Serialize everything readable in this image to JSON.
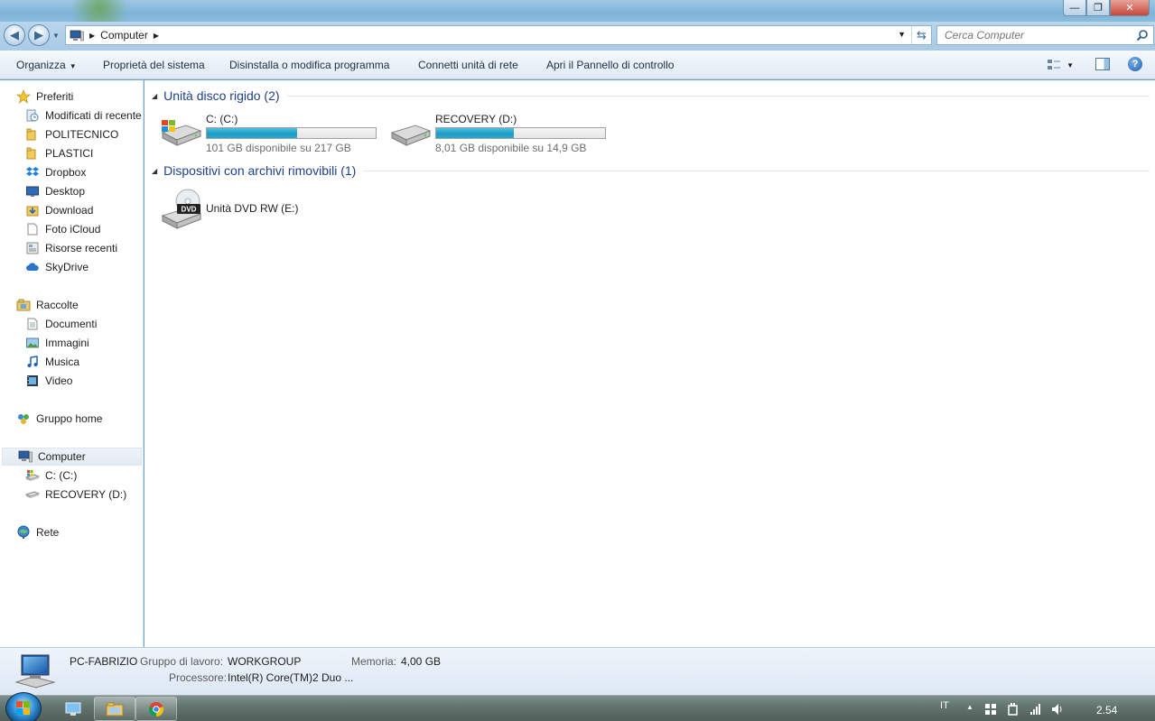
{
  "window": {
    "minimize_label": "—",
    "maximize_label": "❐",
    "close_label": "✕"
  },
  "address": {
    "path": "Computer",
    "search_placeholder": "Cerca Computer"
  },
  "toolbar": {
    "organize": "Organizza",
    "system_properties": "Proprietà del sistema",
    "uninstall": "Disinstalla o modifica programma",
    "map_drive": "Connetti unità di rete",
    "control_panel": "Apri il Pannello di controllo"
  },
  "sidebar": {
    "favorites": "Preferiti",
    "favorites_items": [
      {
        "label": "Modificati di recente",
        "icon": "recent-icon"
      },
      {
        "label": "POLITECNICO",
        "icon": "folder-icon"
      },
      {
        "label": "PLASTICI",
        "icon": "folder-icon"
      },
      {
        "label": "Dropbox",
        "icon": "dropbox-icon"
      },
      {
        "label": "Desktop",
        "icon": "desktop-icon"
      },
      {
        "label": "Download",
        "icon": "download-icon"
      },
      {
        "label": "Foto iCloud",
        "icon": "document-icon"
      },
      {
        "label": "Risorse recenti",
        "icon": "recent-places-icon"
      },
      {
        "label": "SkyDrive",
        "icon": "cloud-icon"
      }
    ],
    "libraries": "Raccolte",
    "libraries_items": [
      {
        "label": "Documenti",
        "icon": "documents-icon"
      },
      {
        "label": "Immagini",
        "icon": "pictures-icon"
      },
      {
        "label": "Musica",
        "icon": "music-icon"
      },
      {
        "label": "Video",
        "icon": "video-icon"
      }
    ],
    "homegroup": "Gruppo home",
    "computer": "Computer",
    "computer_items": [
      {
        "label": "C: (C:)",
        "icon": "windows-drive-icon"
      },
      {
        "label": "RECOVERY (D:)",
        "icon": "drive-icon"
      }
    ],
    "network": "Rete"
  },
  "content": {
    "hdd_group": "Unità disco rigido (2)",
    "removable_group": "Dispositivi con archivi rimovibili (1)",
    "drives": [
      {
        "name": "C: (C:)",
        "free_text": "101 GB disponibile su 217 GB",
        "used_fraction": 0.535
      },
      {
        "name": "RECOVERY (D:)",
        "free_text": "8,01 GB disponibile su 14,9 GB",
        "used_fraction": 0.462
      }
    ],
    "dvd": {
      "name": "Unità DVD RW (E:)",
      "badge": "DVD"
    }
  },
  "details": {
    "pc_name": "PC-FABRIZIO",
    "workgroup_label": "Gruppo di lavoro:",
    "workgroup_value": "WORKGROUP",
    "memory_label": "Memoria:",
    "memory_value": "4,00 GB",
    "processor_label": "Processore:",
    "processor_value": "Intel(R) Core(TM)2 Duo ..."
  },
  "taskbar": {
    "language": "IT",
    "clock": "2.54"
  },
  "colors": {
    "group_title": "#1e3f8a",
    "bar_fill": "#1e9cc6"
  }
}
